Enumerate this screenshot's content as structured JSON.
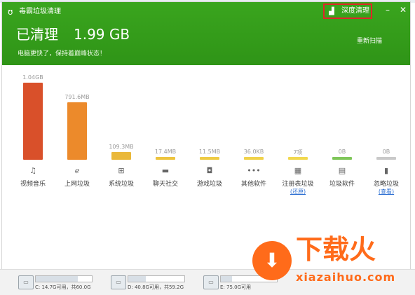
{
  "app": {
    "title": "毒霸垃圾清理"
  },
  "header": {
    "deep_clean_label": "深度清理",
    "cleaned_label": "已清理",
    "cleaned_size": "1.99 GB",
    "subtitle": "电脑更快了，保持着巅峰状态！",
    "rescan_label": "重新扫描"
  },
  "categories": [
    {
      "name": "视频音乐",
      "value": "1.04GB",
      "bytes_mb": 1064,
      "color": "#d9502a",
      "icon": "music-icon",
      "glyph": "♫",
      "action": ""
    },
    {
      "name": "上网垃圾",
      "value": "791.6MB",
      "bytes_mb": 791.6,
      "color": "#ec8a2b",
      "icon": "ie-icon",
      "glyph": "ℯ",
      "action": ""
    },
    {
      "name": "系统垃圾",
      "value": "109.3MB",
      "bytes_mb": 109.3,
      "color": "#eab83a",
      "icon": "windows-icon",
      "glyph": "⊞",
      "action": ""
    },
    {
      "name": "聊天社交",
      "value": "17.4MB",
      "bytes_mb": 17.4,
      "color": "#edc43f",
      "icon": "chat-icon",
      "glyph": "▬",
      "action": ""
    },
    {
      "name": "游戏垃圾",
      "value": "11.5MB",
      "bytes_mb": 11.5,
      "color": "#eecb44",
      "icon": "gamepad-icon",
      "glyph": "◘",
      "action": ""
    },
    {
      "name": "其他软件",
      "value": "36.0KB",
      "bytes_mb": 0.035,
      "color": "#f0d24b",
      "icon": "dots-icon",
      "glyph": "•••",
      "action": ""
    },
    {
      "name": "注册表垃圾",
      "value": "7项",
      "bytes_mb": 0,
      "color": "#f1d84f",
      "icon": "registry-icon",
      "glyph": "▦",
      "action": "(还原)"
    },
    {
      "name": "垃圾软件",
      "value": "0B",
      "bytes_mb": 0,
      "color": "#7fc65a",
      "icon": "package-icon",
      "glyph": "▤",
      "action": ""
    },
    {
      "name": "忽略垃圾",
      "value": "0B",
      "bytes_mb": 0,
      "color": "#c9c9c9",
      "icon": "trash-icon",
      "glyph": "▮",
      "action": "(查看)"
    }
  ],
  "drives": [
    {
      "info": "C: 14.7G可用，共60.0G",
      "used_fraction": 0.755
    },
    {
      "info": "D: 40.8G可用，共59.2G",
      "used_fraction": 0.31
    },
    {
      "info": "E: 75.0G可用",
      "used_fraction": 0.2
    }
  ],
  "watermark": {
    "main": "下载火",
    "url": "xiazaihuo.com"
  }
}
